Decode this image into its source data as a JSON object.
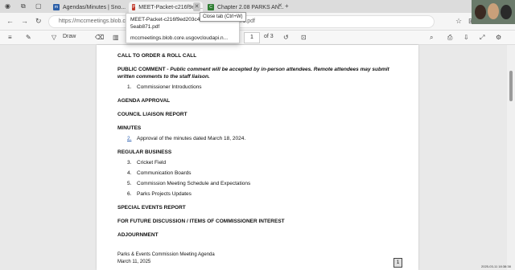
{
  "tabs": [
    {
      "label": "Agendas/Minutes | Sno...",
      "favicon": "mcc-icon"
    },
    {
      "label": "MEET-Packet-c216f9ed...",
      "favicon": "pdf-icon",
      "active": true
    },
    {
      "label": "Chapter 2.08 PARKS AN...",
      "favicon": "code-icon"
    }
  ],
  "tooltip": "Close tab (Ctrl+W)",
  "hover_card": {
    "title": "MEET-Packet-c216f9ed203c4ee0bb3450af65eab871.pdf",
    "host": "mccmeetings.blob.core.usgovcloudapi.n..."
  },
  "address": {
    "url": "https://mccmeetings.blob.c...Packet-c216f9ed203c4ee0bb3450af65eab871.pdf"
  },
  "pdf_toolbar": {
    "draw_label": "Draw",
    "page_current": "1",
    "page_total": "of 3"
  },
  "doc": {
    "call_to_order": "CALL TO ORDER & ROLL CALL",
    "public_comment_head": "PUBLIC COMMENT - ",
    "public_comment_body": "Public comment will be accepted by in-person attendees. Remote attendees may submit",
    "public_comment_body2": "written comments to the staff liaison.",
    "item_1_num": "1.",
    "item_1": "Commissioner Introductions",
    "agenda_approval": "AGENDA APPROVAL",
    "council_liaison": "COUNCIL LIAISON REPORT",
    "minutes": "MINUTES",
    "minutes_item_num": "2.",
    "minutes_item": "Approval of the minutes dated March 18, 2024.",
    "regular_business": "REGULAR BUSINESS",
    "rb": [
      {
        "num": "3.",
        "text": "Cricket Field"
      },
      {
        "num": "4.",
        "text": "Communication Boards"
      },
      {
        "num": "5.",
        "text": "Commission Meeting Schedule and Expectations"
      },
      {
        "num": "6.",
        "text": "Parks Projects Updates"
      }
    ],
    "special_events": "SPECIAL EVENTS REPORT",
    "future_discussion": "FOR FUTURE DISCUSSION / ITEMS OF COMMISSIONER INTEREST",
    "adjournment": "ADJOURNMENT",
    "footer_title": "Parks & Events Commission Meeting Agenda",
    "footer_date": "March 11, 2025",
    "page_number": "1"
  },
  "clock_text": "2025-03-11 18:38:38"
}
